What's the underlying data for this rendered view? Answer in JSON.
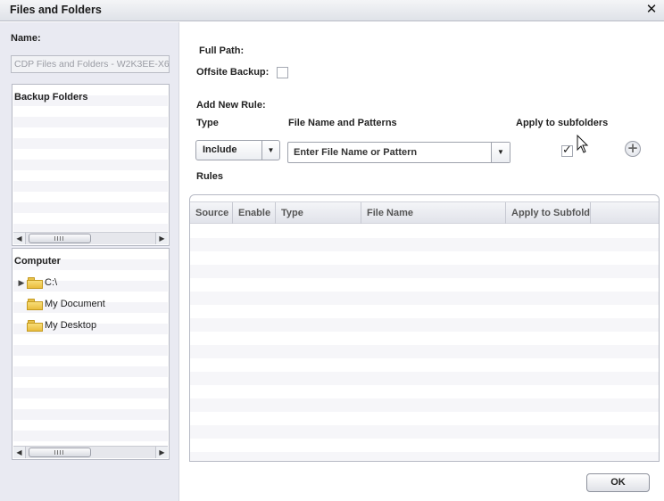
{
  "window": {
    "title": "Files and Folders",
    "close_label": "✕"
  },
  "left": {
    "name_label": "Name:",
    "name_value": "CDP Files and Folders - W2K3EE-X6",
    "backup_folders": {
      "title": "Backup Folders",
      "items": []
    },
    "computer": {
      "title": "Computer",
      "items": [
        {
          "label": "C:\\",
          "expandable": true
        },
        {
          "label": "My Document",
          "expandable": false
        },
        {
          "label": "My Desktop",
          "expandable": false
        }
      ]
    },
    "scroll_arrow_left": "◀",
    "scroll_arrow_right": "▶"
  },
  "right": {
    "full_path_label": "Full Path:",
    "full_path_value": "",
    "offsite_backup_label": "Offsite Backup:",
    "offsite_backup_checked": false,
    "add_rule_label": "Add New Rule:",
    "type_label": "Type",
    "pattern_label": "File Name and Patterns",
    "apply_label": "Apply to subfolders",
    "type_value": "Include",
    "pattern_placeholder": "Enter File Name or Pattern",
    "apply_checked": true,
    "dropdown_arrow": "▼",
    "add_button_glyph": "+",
    "rules_label": "Rules",
    "rules_columns": [
      "Source",
      "Enable",
      "Type",
      "File Name",
      "Apply to Subfolders"
    ],
    "rules_rows": [],
    "ok_label": "OK"
  }
}
